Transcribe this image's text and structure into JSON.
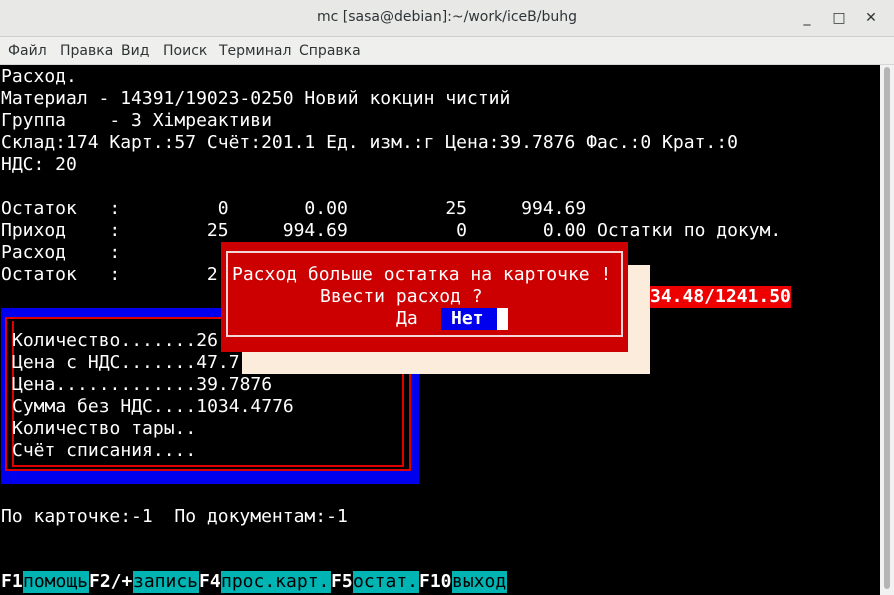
{
  "window": {
    "title": "mc [sasa@debian]:~/work/iceB/buhg",
    "minimize_label": "_",
    "maximize_label": "□",
    "close_label": "✕"
  },
  "menubar": {
    "items": [
      "Файл",
      "Правка",
      "Вид",
      "Поиск",
      "Терминал",
      "Справка"
    ]
  },
  "header": {
    "line1": "Расход.",
    "line2": "Материал - 14391/19023-0250 Новий кокцин чистий",
    "line3": "Группа    - 3 Хімреактиви",
    "line4": "Склад:174 Карт.:57 Счёт:201.1 Ед. изм.:г Цена:39.7876 Фас.:0 Крат.:0",
    "line5": "НДС: 20"
  },
  "balances": {
    "row1": "Остаток   :         0       0.00         25     994.69",
    "row2": "Приход    :        25     994.69          0       0.00 Остатки по докум.",
    "row3": "Расход    :",
    "row4": "Остаток   :        2",
    "total_red": "34.48/1241.50"
  },
  "form": {
    "field1": "Количество.......26",
    "field2": "Цена с НДС.......47.7",
    "field3": "Цена.............39.7876",
    "field4": "Сумма без НДС....1034.4776",
    "field5": "Количество тары..",
    "field6": "Счёт списания...."
  },
  "footer_line": "По карточке:-1  По документам:-1",
  "dialog": {
    "message": "Расход больше остатка на карточке !",
    "question": "Ввести расход ?",
    "yes_label": "Да",
    "no_label": "Нет"
  },
  "fkeys": [
    {
      "key": "F1",
      "label": "помощь"
    },
    {
      "key": "F2/+",
      "label": "запись"
    },
    {
      "key": "F4",
      "label": "прос.карт."
    },
    {
      "key": "F5",
      "label": "остат."
    },
    {
      "key": "F10",
      "label": "выход"
    }
  ],
  "colors": {
    "terminal_bg": "#000000",
    "dialog_bg": "#cc0000",
    "form_bg": "#0000ee",
    "fkey_label_bg": "#00b4b4",
    "highlight_red": "#ee0000"
  }
}
